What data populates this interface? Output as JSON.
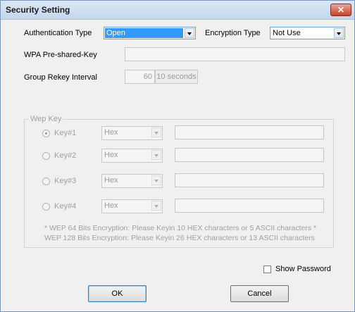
{
  "window": {
    "title": "Security Setting",
    "close_glyph": "✕"
  },
  "auth": {
    "label": "Authentication Type",
    "value": "Open"
  },
  "encryption": {
    "label": "Encryption Type",
    "value": "Not Use"
  },
  "wpa": {
    "label": "WPA Pre-shared-Key",
    "value": ""
  },
  "rekey": {
    "label": "Group Rekey Interval",
    "value": "60",
    "unit": "10 seconds"
  },
  "wep": {
    "group_label": "Wep Key",
    "keys": [
      {
        "label": "Key#1",
        "format": "Hex",
        "value": "",
        "selected": true
      },
      {
        "label": "Key#2",
        "format": "Hex",
        "value": "",
        "selected": false
      },
      {
        "label": "Key#3",
        "format": "Hex",
        "value": "",
        "selected": false
      },
      {
        "label": "Key#4",
        "format": "Hex",
        "value": "",
        "selected": false
      }
    ],
    "note1": "* WEP 64 Bits Encryption:  Please Keyin 10 HEX characters or 5 ASCII characters *",
    "note2": "WEP 128 Bits Encryption:  Please Keyin 26 HEX characters or 13 ASCII characters"
  },
  "show_password": {
    "label": "Show Password",
    "checked": false
  },
  "buttons": {
    "ok": "OK",
    "cancel": "Cancel"
  }
}
